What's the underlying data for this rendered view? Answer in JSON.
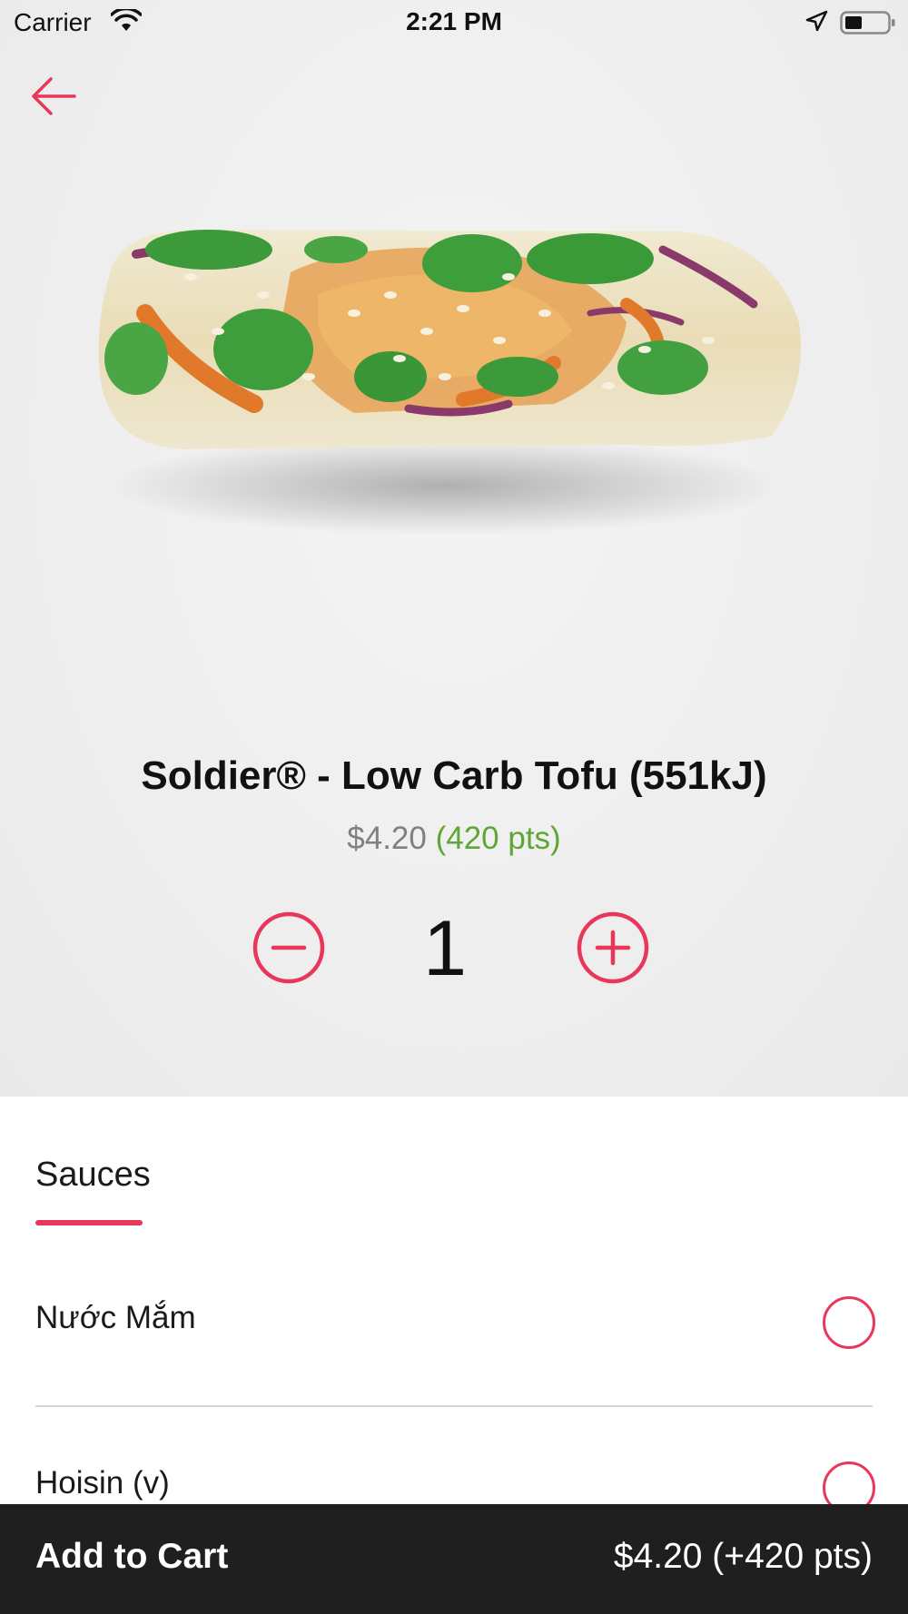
{
  "status_bar": {
    "carrier": "Carrier",
    "time": "2:21 PM",
    "icons": [
      "wifi-icon",
      "location-icon",
      "battery-icon"
    ]
  },
  "nav": {
    "back_icon": "arrow-left-icon"
  },
  "product": {
    "image": "rice-paper-roll",
    "title": "Soldier® - Low Carb Tofu (551kJ)",
    "price": "$4.20",
    "points": "(420 pts)"
  },
  "quantity": {
    "value": "1",
    "minus_icon": "minus-circle-icon",
    "plus_icon": "plus-circle-icon"
  },
  "options": {
    "section_label": "Sauces",
    "items": [
      {
        "label": "Nước Mắm",
        "selected": false
      },
      {
        "label": "Hoisin (v)",
        "selected": false
      }
    ]
  },
  "cart": {
    "label": "Add to Cart",
    "total": "$4.20 (+420 pts)"
  },
  "colors": {
    "accent": "#e8375a",
    "points_green": "#5fa636",
    "cart_bar": "#1f1f1f"
  }
}
